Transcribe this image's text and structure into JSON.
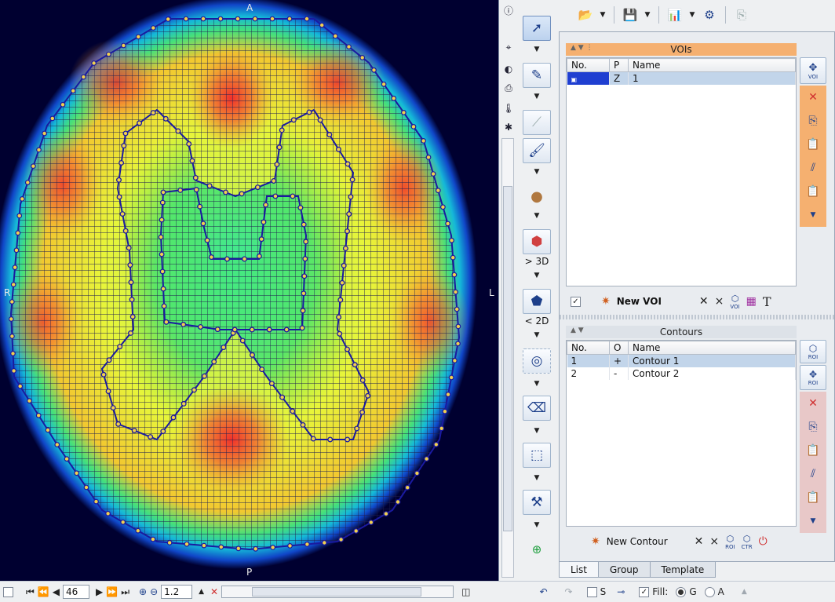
{
  "viewport": {
    "orientation": {
      "top": "A",
      "bottom": "P",
      "left": "R",
      "right": "L"
    },
    "colors": {
      "background": "#000030",
      "contour": "#1a1aa0",
      "grid": "#222244"
    }
  },
  "tools": {
    "labels": {
      "to3d": "> 3D",
      "to2d": "< 2D"
    }
  },
  "vois": {
    "header": "VOIs",
    "columns": [
      "No.",
      "P",
      "Name"
    ],
    "rows": [
      {
        "no": "",
        "p": "Z",
        "name": "1"
      }
    ],
    "new_label": "New VOI"
  },
  "contours": {
    "header": "Contours",
    "columns": [
      "No.",
      "O",
      "Name"
    ],
    "rows": [
      {
        "no": "1",
        "o": "+",
        "name": "Contour 1"
      },
      {
        "no": "2",
        "o": "-",
        "name": "Contour 2"
      }
    ],
    "new_label": "New Contour"
  },
  "side_labels": {
    "voi": "VOI",
    "roi": "ROI",
    "ctr": "CTR"
  },
  "tabs": [
    "List",
    "Group",
    "Template"
  ],
  "status": {
    "slice": "46",
    "zoom": "1.2",
    "s_label": "S",
    "fill_label": "Fill:",
    "g_label": "G",
    "a_label": "A"
  }
}
